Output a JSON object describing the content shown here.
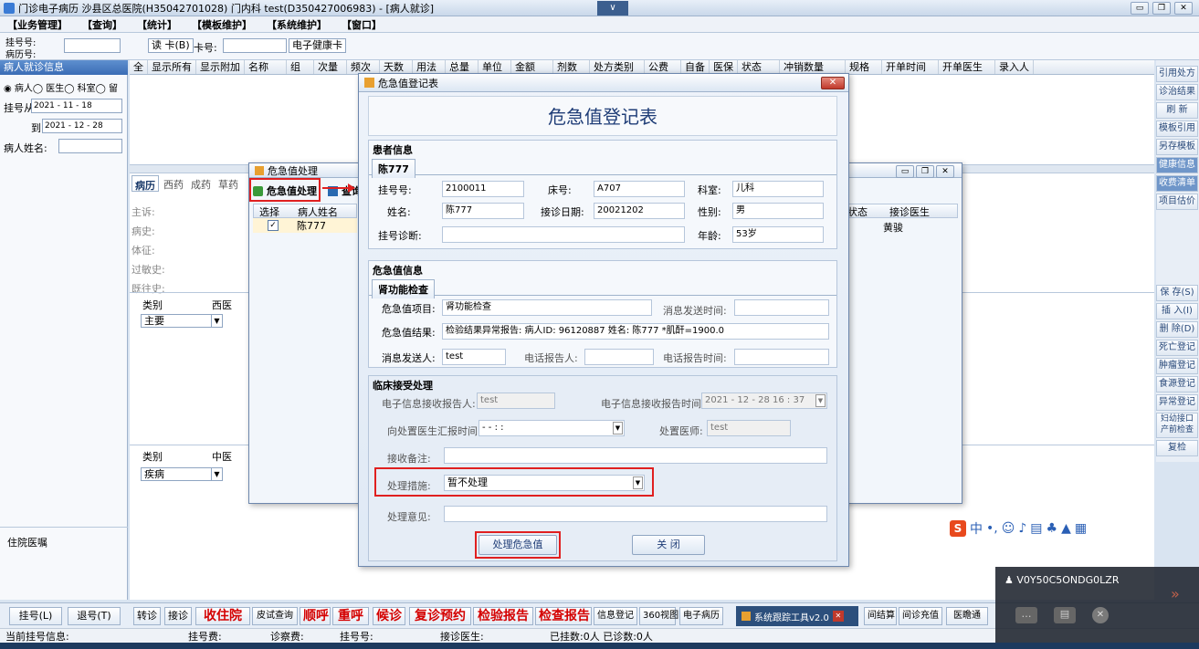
{
  "window": {
    "title": "门诊电子病历 沙县区总医院(H35042701028) 门内科 test(D350427006983) - [病人就诊]"
  },
  "menu": [
    "【业务管理】",
    "【查询】",
    "【统计】",
    "【模板维护】",
    "【系统维护】",
    "【窗口】"
  ],
  "toolbar": {
    "reg_label": "挂号号:",
    "record_label": "病历号:",
    "read_card": "读 卡(B)",
    "card_no": "卡号:",
    "health_card": "电子健康卡"
  },
  "left": {
    "title": "病人就诊信息",
    "radios": "◉ 病人◯ 医生◯ 科室◯ 留",
    "reg_from_label": "挂号从",
    "reg_from": "2021 - 11 - 18",
    "to_label": "到",
    "reg_to": "2021 - 12 - 28",
    "name_label": "病人姓名:",
    "hospital_order": "住院医嘱"
  },
  "grid": {
    "headers": [
      "全",
      "显示所有",
      "显示附加",
      "名称",
      "组",
      "次量",
      "频次",
      "天数",
      "用法",
      "总量",
      "单位",
      "金额",
      "剂数",
      "处方类别",
      "公费",
      "自备",
      "医保",
      "状态",
      "冲销数量",
      "规格",
      "开单时间",
      "开单医生",
      "录入人"
    ]
  },
  "right_buttons": [
    "引用处方",
    "诊治结果",
    "刷 新",
    "模板引用",
    "另存模板",
    "健康信息",
    "收费清单",
    "项目估价",
    "保 存(S)",
    "插 入(I)",
    "删 除(D)",
    "死亡登记",
    "肿瘤登记",
    "食源登记",
    "异常登记",
    "妇幼接口产前检查",
    "复检"
  ],
  "emr": {
    "tabs": [
      "病历",
      "西药",
      "成药",
      "草药"
    ],
    "fields": [
      "主诉:",
      "病史:",
      "体征:",
      "过敏史:",
      "既往史:"
    ],
    "table1": {
      "col1": "类别",
      "col2": "西医",
      "val": "主要"
    },
    "table2": {
      "col1": "类别",
      "col2": "中医",
      "val": "疾病"
    }
  },
  "proc_dialog": {
    "title": "危急值处理",
    "btn_proc": "危急值处理",
    "btn_query": "查询",
    "cols": [
      "选择",
      "病人姓名"
    ],
    "row_name": "陈777",
    "right_cols": [
      "状态",
      "接诊医生"
    ],
    "doctor": "黄骏"
  },
  "reg_dialog": {
    "title": "危急值登记表",
    "heading": "危急值登记表",
    "patient": {
      "group": "患者信息",
      "tab": "陈777",
      "reg_no_label": "挂号号:",
      "reg_no": "2100011",
      "bed_label": "床号:",
      "bed": "A707",
      "dept_label": "科室:",
      "dept": "儿科",
      "name_label": "姓名:",
      "name": "陈777",
      "date_label": "接诊日期:",
      "date": "20021202",
      "sex_label": "性别:",
      "sex": "男",
      "diag_label": "挂号诊断:",
      "age_label": "年龄:",
      "age": "53岁"
    },
    "critical": {
      "group": "危急值信息",
      "tab": "肾功能检查",
      "item_label": "危急值项目:",
      "item": "肾功能检查",
      "send_time_label": "消息发送时间:",
      "result_label": "危急值结果:",
      "result": "检验结果异常报告: 病人ID: 96120887 姓名: 陈777 *肌酐=1900.0",
      "sender_label": "消息发送人:",
      "sender": "test",
      "phone_rep_label": "电话报告人:",
      "phone_time_label": "电话报告时间:"
    },
    "clinical": {
      "group": "临床接受处理",
      "recv_label": "电子信息接收报告人:",
      "recv": "test",
      "recv_time_label": "电子信息接收报告时间:",
      "recv_time": "2021 - 12 - 28  16 : 37",
      "report_time_label": "向处置医生汇报时间:",
      "report_time": "-  -       :   :",
      "doctor_label": "处置医师:",
      "doctor": "test",
      "remark_label": "接收备注:",
      "measure_label": "处理措施:",
      "measure": "暂不处理",
      "opinion_label": "处理意见:"
    },
    "btn_process": "处理危急值",
    "btn_close": "关 闭"
  },
  "bottom": {
    "reg": "挂号(L)",
    "unreg": "退号(T)",
    "btns": [
      "转诊",
      "接诊",
      "收住院",
      "皮试查询",
      "顺呼",
      "重呼",
      "候诊",
      "复诊预约",
      "检验报告",
      "检查报告",
      "信息登记",
      "360视图",
      "电子病历"
    ],
    "right_btns": [
      "间结算",
      "间诊充值",
      "医瞻通"
    ],
    "tracker": "系统跟踪工具v2.0"
  },
  "status": {
    "cur": "当前挂号信息:",
    "fee": "挂号费:",
    "diag_fee": "诊察费:",
    "no": "挂号号:",
    "doctor": "接诊医生:",
    "counts": "已挂数:0人 已诊数:0人"
  },
  "ime": {
    "label": "中"
  },
  "notice": {
    "user": "V0Y50C5ONDG0LZR"
  },
  "colors": {
    "accent": "#3b6db5",
    "highlight": "#e02020"
  }
}
